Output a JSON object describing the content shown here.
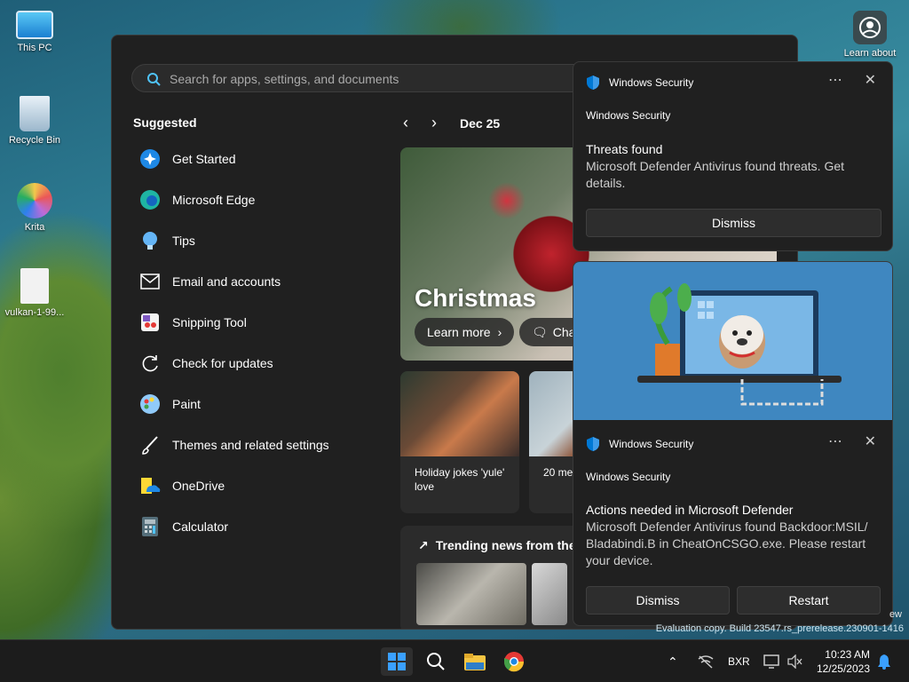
{
  "desktop": {
    "icons": [
      {
        "label": "This PC"
      },
      {
        "label": "Recycle Bin"
      },
      {
        "label": "Krita"
      },
      {
        "label": "vulkan-1-99..."
      }
    ],
    "learn_about": "Learn about",
    "watermark": "Evaluation copy. Build 23547.rs_prerelease.230901-1416",
    "watermark_edge": "ew"
  },
  "start": {
    "search_placeholder": "Search for apps, settings, and documents",
    "suggested_title": "Suggested",
    "suggested": [
      {
        "label": "Get Started",
        "icon": "get-started-icon"
      },
      {
        "label": "Microsoft Edge",
        "icon": "edge-icon"
      },
      {
        "label": "Tips",
        "icon": "tips-icon"
      },
      {
        "label": "Email and accounts",
        "icon": "mail-icon"
      },
      {
        "label": "Snipping Tool",
        "icon": "snipping-tool-icon"
      },
      {
        "label": "Check for updates",
        "icon": "refresh-icon"
      },
      {
        "label": "Paint",
        "icon": "paint-icon"
      },
      {
        "label": "Themes and related settings",
        "icon": "brush-icon"
      },
      {
        "label": "OneDrive",
        "icon": "onedrive-icon"
      },
      {
        "label": "Calculator",
        "icon": "calculator-icon"
      }
    ],
    "date": "Dec 25",
    "hero_title": "Christmas",
    "learn_more": "Learn more",
    "chat_label": "Cha",
    "cards": [
      {
        "caption": "Holiday jokes 'yule' love"
      },
      {
        "caption": "20 me Santa"
      }
    ],
    "trending_title": "Trending news from the"
  },
  "notifications": [
    {
      "app": "Windows Security",
      "source": "Windows Security",
      "title": "Threats found",
      "body": "Microsoft Defender Antivirus found threats. Get details.",
      "buttons": [
        "Dismiss"
      ]
    },
    {
      "app": "Windows Security",
      "source": "Windows Security",
      "title": "Actions needed in Microsoft Defender",
      "body": "Microsoft Defender Antivirus found Backdoor:MSIL/ Bladabindi.B in CheatOnCSGO.exe. Please restart your device.",
      "buttons": [
        "Dismiss",
        "Restart"
      ]
    }
  ],
  "taskbar": {
    "lang": "BXR",
    "time": "10:23 AM",
    "date": "12/25/2023"
  },
  "colors": {
    "accent": "#0078d4",
    "panel": "#202020"
  }
}
